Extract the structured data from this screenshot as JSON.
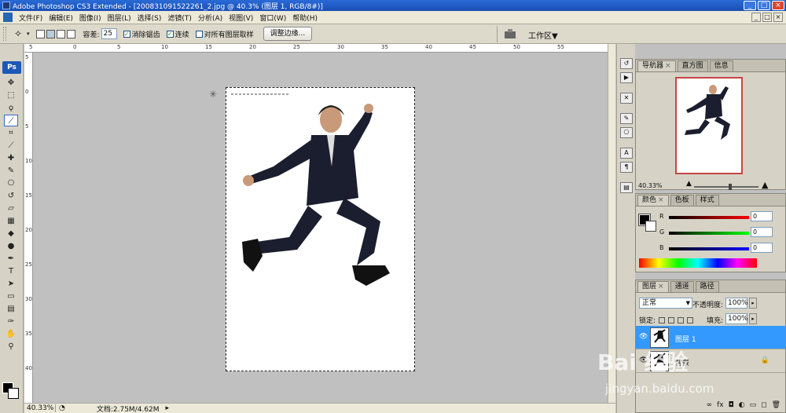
{
  "window": {
    "title": "Adobe Photoshop CS3 Extended - [200831091522261_2.jpg @ 40.3% (图层 1, RGB/8#)]",
    "minimize": "_",
    "restore": "□",
    "close": "×"
  },
  "menu": [
    "文件(F)",
    "编辑(E)",
    "图像(I)",
    "图层(L)",
    "选择(S)",
    "滤镜(T)",
    "分析(A)",
    "视图(V)",
    "窗口(W)",
    "帮助(H)"
  ],
  "options": {
    "tolerance_label": "容差:",
    "tolerance_value": "25",
    "antialias_label": "消除锯齿",
    "contiguous_label": "连续",
    "sample_all_label": "对所有图层取样",
    "refine_edge_button": "调整边缘...",
    "workspace_label": "工作区▼"
  },
  "toolbox": {
    "badge": "Ps",
    "tools": [
      {
        "name": "move-tool",
        "glyph": "✥"
      },
      {
        "name": "marquee-tool",
        "glyph": "⬚"
      },
      {
        "name": "lasso-tool",
        "glyph": "ϙ"
      },
      {
        "name": "magic-wand-tool",
        "glyph": "⟋",
        "active": true
      },
      {
        "name": "crop-tool",
        "glyph": "⌗"
      },
      {
        "name": "slice-tool",
        "glyph": "⟋"
      },
      {
        "name": "healing-tool",
        "glyph": "✚"
      },
      {
        "name": "brush-tool",
        "glyph": "✎"
      },
      {
        "name": "stamp-tool",
        "glyph": "⎔"
      },
      {
        "name": "history-brush-tool",
        "glyph": "↺"
      },
      {
        "name": "eraser-tool",
        "glyph": "▱"
      },
      {
        "name": "gradient-tool",
        "glyph": "▦"
      },
      {
        "name": "blur-tool",
        "glyph": "◆"
      },
      {
        "name": "dodge-tool",
        "glyph": "●"
      },
      {
        "name": "pen-tool",
        "glyph": "✒"
      },
      {
        "name": "type-tool",
        "glyph": "T"
      },
      {
        "name": "path-select-tool",
        "glyph": "➤"
      },
      {
        "name": "shape-tool",
        "glyph": "▭"
      },
      {
        "name": "notes-tool",
        "glyph": "▤"
      },
      {
        "name": "eyedropper-tool",
        "glyph": "✑"
      },
      {
        "name": "hand-tool",
        "glyph": "✋"
      },
      {
        "name": "zoom-tool",
        "glyph": "⚲"
      }
    ]
  },
  "ruler_top_ticks": [
    "5",
    "0",
    "5",
    "10",
    "15",
    "20",
    "25",
    "30",
    "35",
    "40",
    "45",
    "50",
    "55"
  ],
  "ruler_left_ticks": [
    "5",
    "0",
    "5",
    "10",
    "15",
    "20",
    "25",
    "30",
    "35",
    "40"
  ],
  "status": {
    "zoom": "40.33%",
    "doc": "文档:2.75M/4.62M"
  },
  "navigator": {
    "tabs": [
      "导航器",
      "直方图",
      "信息"
    ],
    "zoom": "40.33%"
  },
  "color": {
    "tabs": [
      "颜色",
      "色板",
      "样式"
    ],
    "channels": [
      {
        "label": "R",
        "value": "0",
        "color": "#c01010"
      },
      {
        "label": "G",
        "value": "0",
        "color": "#10a010"
      },
      {
        "label": "B",
        "value": "0",
        "color": "#1020c0"
      }
    ]
  },
  "layers": {
    "tabs": [
      "图层",
      "通道",
      "路径"
    ],
    "blend_mode": "正常",
    "opacity_label": "不透明度:",
    "opacity": "100%",
    "lock_label": "锁定:",
    "fill_label": "填充:",
    "fill": "100%",
    "items": [
      {
        "name": "图层 1",
        "selected": true
      },
      {
        "name": "背景",
        "selected": false
      }
    ]
  },
  "watermark": {
    "main": "Bai 经验",
    "sub": "jingyan.baidu.com"
  },
  "colors": {
    "title_bar": "#1a4fb5",
    "selection": "#3399ff",
    "canvas_bg": "#c0c0c0"
  }
}
